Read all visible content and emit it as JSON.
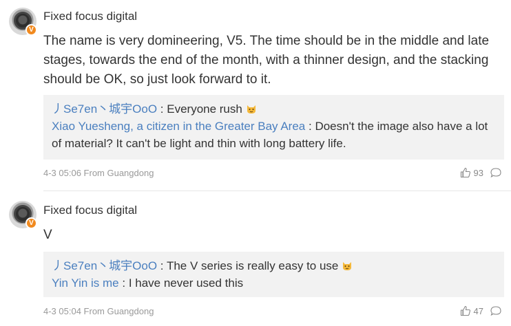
{
  "comments": [
    {
      "username": "Fixed focus digital",
      "badge": "V",
      "text": "The name is very domineering, V5. The time should be in the middle and late stages, towards the end of the month, with a thinner design, and the stacking should be OK, so just look forward to it.",
      "replies": [
        {
          "author": "丿Se7en丶城宇OoO",
          "sep": " : ",
          "text": "Everyone rush",
          "emoji": "cat-face-emoji"
        },
        {
          "author": "Xiao Yuesheng, a citizen in the Greater Bay Area",
          "sep": " : ",
          "text": "Doesn't the image also have a lot of material? It can't be light and thin with long battery life."
        }
      ],
      "meta": "4-3 05:06 From Guangdong",
      "likes": "93"
    },
    {
      "username": "Fixed focus digital",
      "badge": "V",
      "text": "V",
      "replies": [
        {
          "author": "丿Se7en丶城宇OoO",
          "sep": " : ",
          "text": "The V series is really easy to use",
          "emoji": "cat-face-emoji"
        },
        {
          "author": "Yin Yin is me",
          "sep": " : ",
          "text": "I have never used this"
        }
      ],
      "meta": "4-3 05:04 From Guangdong",
      "likes": "47"
    }
  ],
  "colors": {
    "link": "#4a7fbf",
    "badge": "#f18a1f",
    "reply_bg": "#f2f2f2",
    "meta": "#999999"
  }
}
